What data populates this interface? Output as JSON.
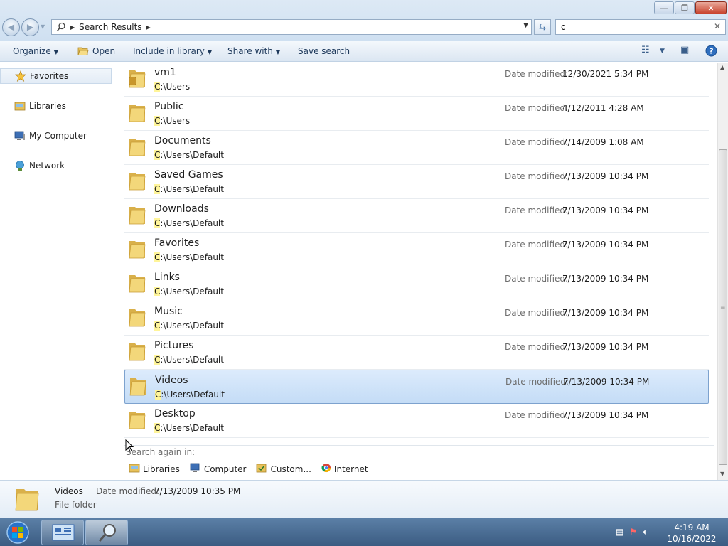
{
  "window": {
    "buttons": {
      "minimize": "—",
      "maximize": "❐",
      "close": "✕"
    }
  },
  "address": {
    "crumbs": [
      "Search Results"
    ]
  },
  "search": {
    "value": "c"
  },
  "toolbar": {
    "organize": "Organize",
    "open": "Open",
    "include_in_library": "Include in library",
    "share_with": "Share with",
    "save_search": "Save search"
  },
  "nav": {
    "items": [
      {
        "label": "Favorites"
      },
      {
        "label": "Libraries"
      },
      {
        "label": "My Computer"
      },
      {
        "label": "Network"
      }
    ]
  },
  "results": {
    "date_label": "Date modified:",
    "path_highlight": "C",
    "rows": [
      {
        "name": "vm1",
        "path_rest": ":\\Users",
        "date": "12/30/2021 5:34 PM",
        "locked": true,
        "selected": false
      },
      {
        "name": "Public",
        "path_rest": ":\\Users",
        "date": "4/12/2011 4:28 AM",
        "locked": false,
        "selected": false
      },
      {
        "name": "Documents",
        "path_rest": ":\\Users\\Default",
        "date": "7/14/2009 1:08 AM",
        "locked": false,
        "selected": false
      },
      {
        "name": "Saved Games",
        "path_rest": ":\\Users\\Default",
        "date": "7/13/2009 10:34 PM",
        "locked": false,
        "selected": false
      },
      {
        "name": "Downloads",
        "path_rest": ":\\Users\\Default",
        "date": "7/13/2009 10:34 PM",
        "locked": false,
        "selected": false
      },
      {
        "name": "Favorites",
        "path_rest": ":\\Users\\Default",
        "date": "7/13/2009 10:34 PM",
        "locked": false,
        "selected": false
      },
      {
        "name": "Links",
        "path_rest": ":\\Users\\Default",
        "date": "7/13/2009 10:34 PM",
        "locked": false,
        "selected": false
      },
      {
        "name": "Music",
        "path_rest": ":\\Users\\Default",
        "date": "7/13/2009 10:34 PM",
        "locked": false,
        "selected": false
      },
      {
        "name": "Pictures",
        "path_rest": ":\\Users\\Default",
        "date": "7/13/2009 10:34 PM",
        "locked": false,
        "selected": false
      },
      {
        "name": "Videos",
        "path_rest": ":\\Users\\Default",
        "date": "7/13/2009 10:34 PM",
        "locked": false,
        "selected": true
      },
      {
        "name": "Desktop",
        "path_rest": ":\\Users\\Default",
        "date": "7/13/2009 10:34 PM",
        "locked": false,
        "selected": false
      }
    ]
  },
  "search_again": {
    "label": "Search again in:",
    "items": [
      "Libraries",
      "Computer",
      "Custom...",
      "Internet"
    ]
  },
  "details": {
    "name": "Videos",
    "type": "File folder",
    "date_label": "Date modified:",
    "date_value": "7/13/2009 10:35 PM"
  },
  "taskbar": {
    "time": "4:19 AM",
    "date": "10/16/2022"
  },
  "colors": {
    "folder": "#f3d77a",
    "folder_dark": "#d9b04a",
    "selection": "#c4dcf6",
    "highlight": "#fff59a"
  }
}
